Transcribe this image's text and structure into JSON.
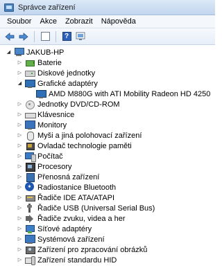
{
  "window": {
    "title": "Správce zařízení"
  },
  "menu": {
    "items": [
      "Soubor",
      "Akce",
      "Zobrazit",
      "Nápověda"
    ]
  },
  "toolbar": {
    "buttons": [
      "back-arrow-icon",
      "forward-arrow-icon",
      "properties-icon",
      "help-icon",
      "scan-icon"
    ],
    "help_glyph": "?"
  },
  "tree": {
    "root": "JAKUB-HP",
    "categories": [
      {
        "label": "Baterie",
        "icon": "battery-icon",
        "expanded": false
      },
      {
        "label": "Diskové jednotky",
        "icon": "disk-icon",
        "expanded": false
      },
      {
        "label": "Grafické adaptéry",
        "icon": "display-adapter-icon",
        "expanded": true,
        "children": [
          "AMD M880G with ATI Mobility Radeon HD 4250"
        ]
      },
      {
        "label": "Jednotky DVD/CD-ROM",
        "icon": "dvd-icon",
        "expanded": false
      },
      {
        "label": "Klávesnice",
        "icon": "keyboard-icon",
        "expanded": false
      },
      {
        "label": "Monitory",
        "icon": "monitor-icon",
        "expanded": false
      },
      {
        "label": "Myši a jiná polohovací zařízení",
        "icon": "mouse-icon",
        "expanded": false
      },
      {
        "label": "Ovladač technologie paměti",
        "icon": "memory-chip-icon",
        "expanded": false
      },
      {
        "label": "Počítač",
        "icon": "computer-icon",
        "expanded": false
      },
      {
        "label": "Procesory",
        "icon": "cpu-icon",
        "expanded": false
      },
      {
        "label": "Přenosná zařízení",
        "icon": "portable-device-icon",
        "expanded": false
      },
      {
        "label": "Radiostanice Bluetooth",
        "icon": "bluetooth-icon",
        "expanded": false
      },
      {
        "label": "Řadiče IDE ATA/ATAPI",
        "icon": "ide-controller-icon",
        "expanded": false
      },
      {
        "label": "Řadiče USB (Universal Serial Bus)",
        "icon": "usb-icon",
        "expanded": false
      },
      {
        "label": "Řadiče zvuku, videa a her",
        "icon": "sound-icon",
        "expanded": false
      },
      {
        "label": "Síťové adaptéry",
        "icon": "network-adapter-icon",
        "expanded": false
      },
      {
        "label": "Systémová zařízení",
        "icon": "system-device-icon",
        "expanded": false
      },
      {
        "label": "Zařízení pro zpracování obrázků",
        "icon": "imaging-device-icon",
        "expanded": false
      },
      {
        "label": "Zařízení standardu HID",
        "icon": "hid-icon",
        "expanded": false
      }
    ]
  },
  "colors": {
    "titlebar": "#c8daf0",
    "menubar": "#f4f7fc",
    "selection": "#cce8ff"
  }
}
